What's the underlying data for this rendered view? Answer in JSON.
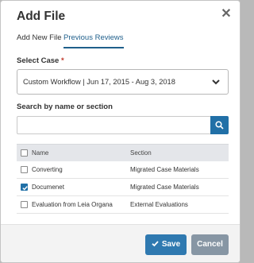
{
  "dialog": {
    "title": "Add File"
  },
  "tabs": [
    {
      "label": "Add New File",
      "active": false
    },
    {
      "label": "Previous Reviews",
      "active": true
    }
  ],
  "case_select": {
    "label": "Select Case",
    "required_marker": "*",
    "value": "Custom Workflow | Jun 17, 2015 - Aug 3, 2018"
  },
  "search": {
    "label": "Search by name or section",
    "value": "",
    "placeholder": ""
  },
  "table": {
    "columns": [
      "Name",
      "Section"
    ],
    "rows": [
      {
        "name": "Converting",
        "section": "Migrated Case Materials",
        "checked": false
      },
      {
        "name": "Documenet",
        "section": "Migrated Case Materials",
        "checked": true
      },
      {
        "name": "Evaluation from Leia Organa",
        "section": "External Evaluations",
        "checked": false
      }
    ]
  },
  "footer": {
    "save_label": "Save",
    "cancel_label": "Cancel"
  },
  "colors": {
    "accent": "#2170a7",
    "cancel": "#8796a4",
    "required": "#c0392b"
  }
}
